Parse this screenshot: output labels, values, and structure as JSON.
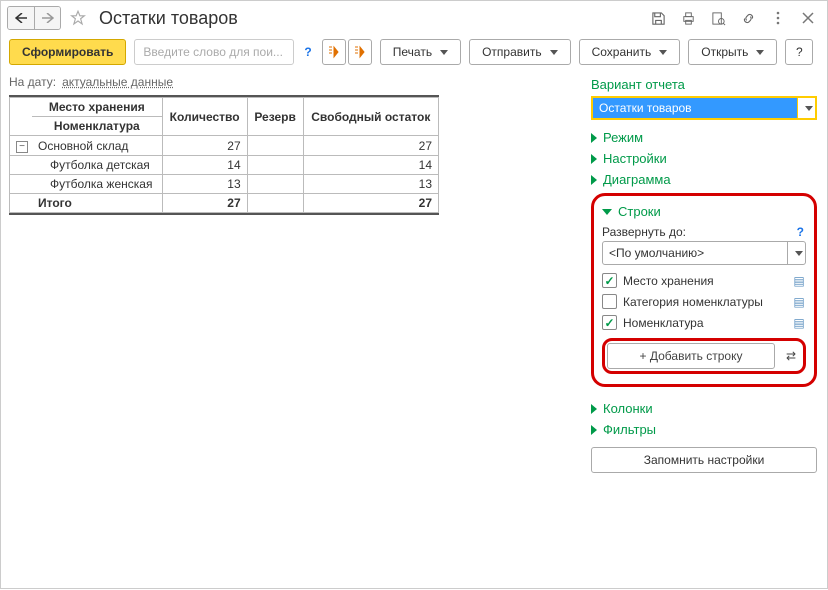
{
  "header": {
    "title": "Остатки товаров"
  },
  "toolbar": {
    "generate": "Сформировать",
    "search_placeholder": "Введите слово для пои...",
    "print": "Печать",
    "send": "Отправить",
    "save": "Сохранить",
    "open": "Открыть",
    "help": "?"
  },
  "date_line": {
    "label": "На дату:",
    "value": "актуальные данные"
  },
  "table": {
    "col_storage": "Место хранения",
    "col_nomenclature": "Номенклатура",
    "col_qty": "Количество",
    "col_reserve": "Резерв",
    "col_free": "Свободный остаток",
    "rows": [
      {
        "name": "Основной склад",
        "qty": "27",
        "reserve": "",
        "free": "27",
        "indent": 0
      },
      {
        "name": "Футболка детская",
        "qty": "14",
        "reserve": "",
        "free": "14",
        "indent": 1
      },
      {
        "name": "Футболка женская",
        "qty": "13",
        "reserve": "",
        "free": "13",
        "indent": 1
      }
    ],
    "total_label": "Итого",
    "total_qty": "27",
    "total_reserve": "",
    "total_free": "27"
  },
  "panel": {
    "variant_label": "Вариант отчета",
    "variant_value": "Остатки товаров",
    "sections": {
      "mode": "Режим",
      "settings": "Настройки",
      "chart": "Диаграмма",
      "rows": "Строки",
      "columns": "Колонки",
      "filters": "Фильтры"
    },
    "rows_block": {
      "expand_label": "Развернуть до:",
      "expand_value": "<По умолчанию>",
      "items": [
        {
          "label": "Место хранения",
          "checked": true
        },
        {
          "label": "Категория номенклатуры",
          "checked": false
        },
        {
          "label": "Номенклатура",
          "checked": true
        }
      ],
      "add_row": "+ Добавить строку"
    },
    "save_settings": "Запомнить настройки",
    "help": "?"
  }
}
